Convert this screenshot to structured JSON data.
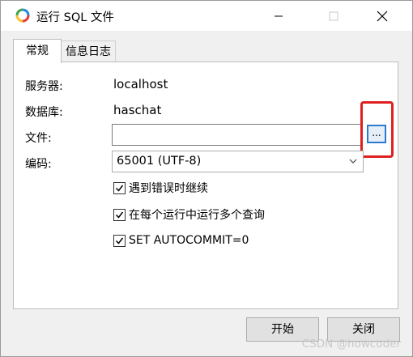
{
  "window": {
    "title": "运行 SQL 文件",
    "icon": "colorful-ring-app-icon"
  },
  "tabs": [
    {
      "label": "常规",
      "active": true
    },
    {
      "label": "信息日志",
      "active": false
    }
  ],
  "fields": {
    "server_label": "服务器:",
    "server_value": "localhost",
    "database_label": "数据库:",
    "database_value": "haschat",
    "file_label": "文件:",
    "file_value": "",
    "file_browse_label": "...",
    "encoding_label": "编码:",
    "encoding_value": "65001 (UTF-8)"
  },
  "options": [
    {
      "label": "遇到错误时继续",
      "checked": true
    },
    {
      "label": "在每个运行中运行多个查询",
      "checked": true
    },
    {
      "label": "SET AUTOCOMMIT=0",
      "checked": true
    }
  ],
  "buttons": {
    "start": "开始",
    "close": "关闭"
  },
  "watermark": "CSDN @howcoder",
  "colors": {
    "highlight": "#e02020",
    "focus_blue": "#2a7bd0"
  }
}
